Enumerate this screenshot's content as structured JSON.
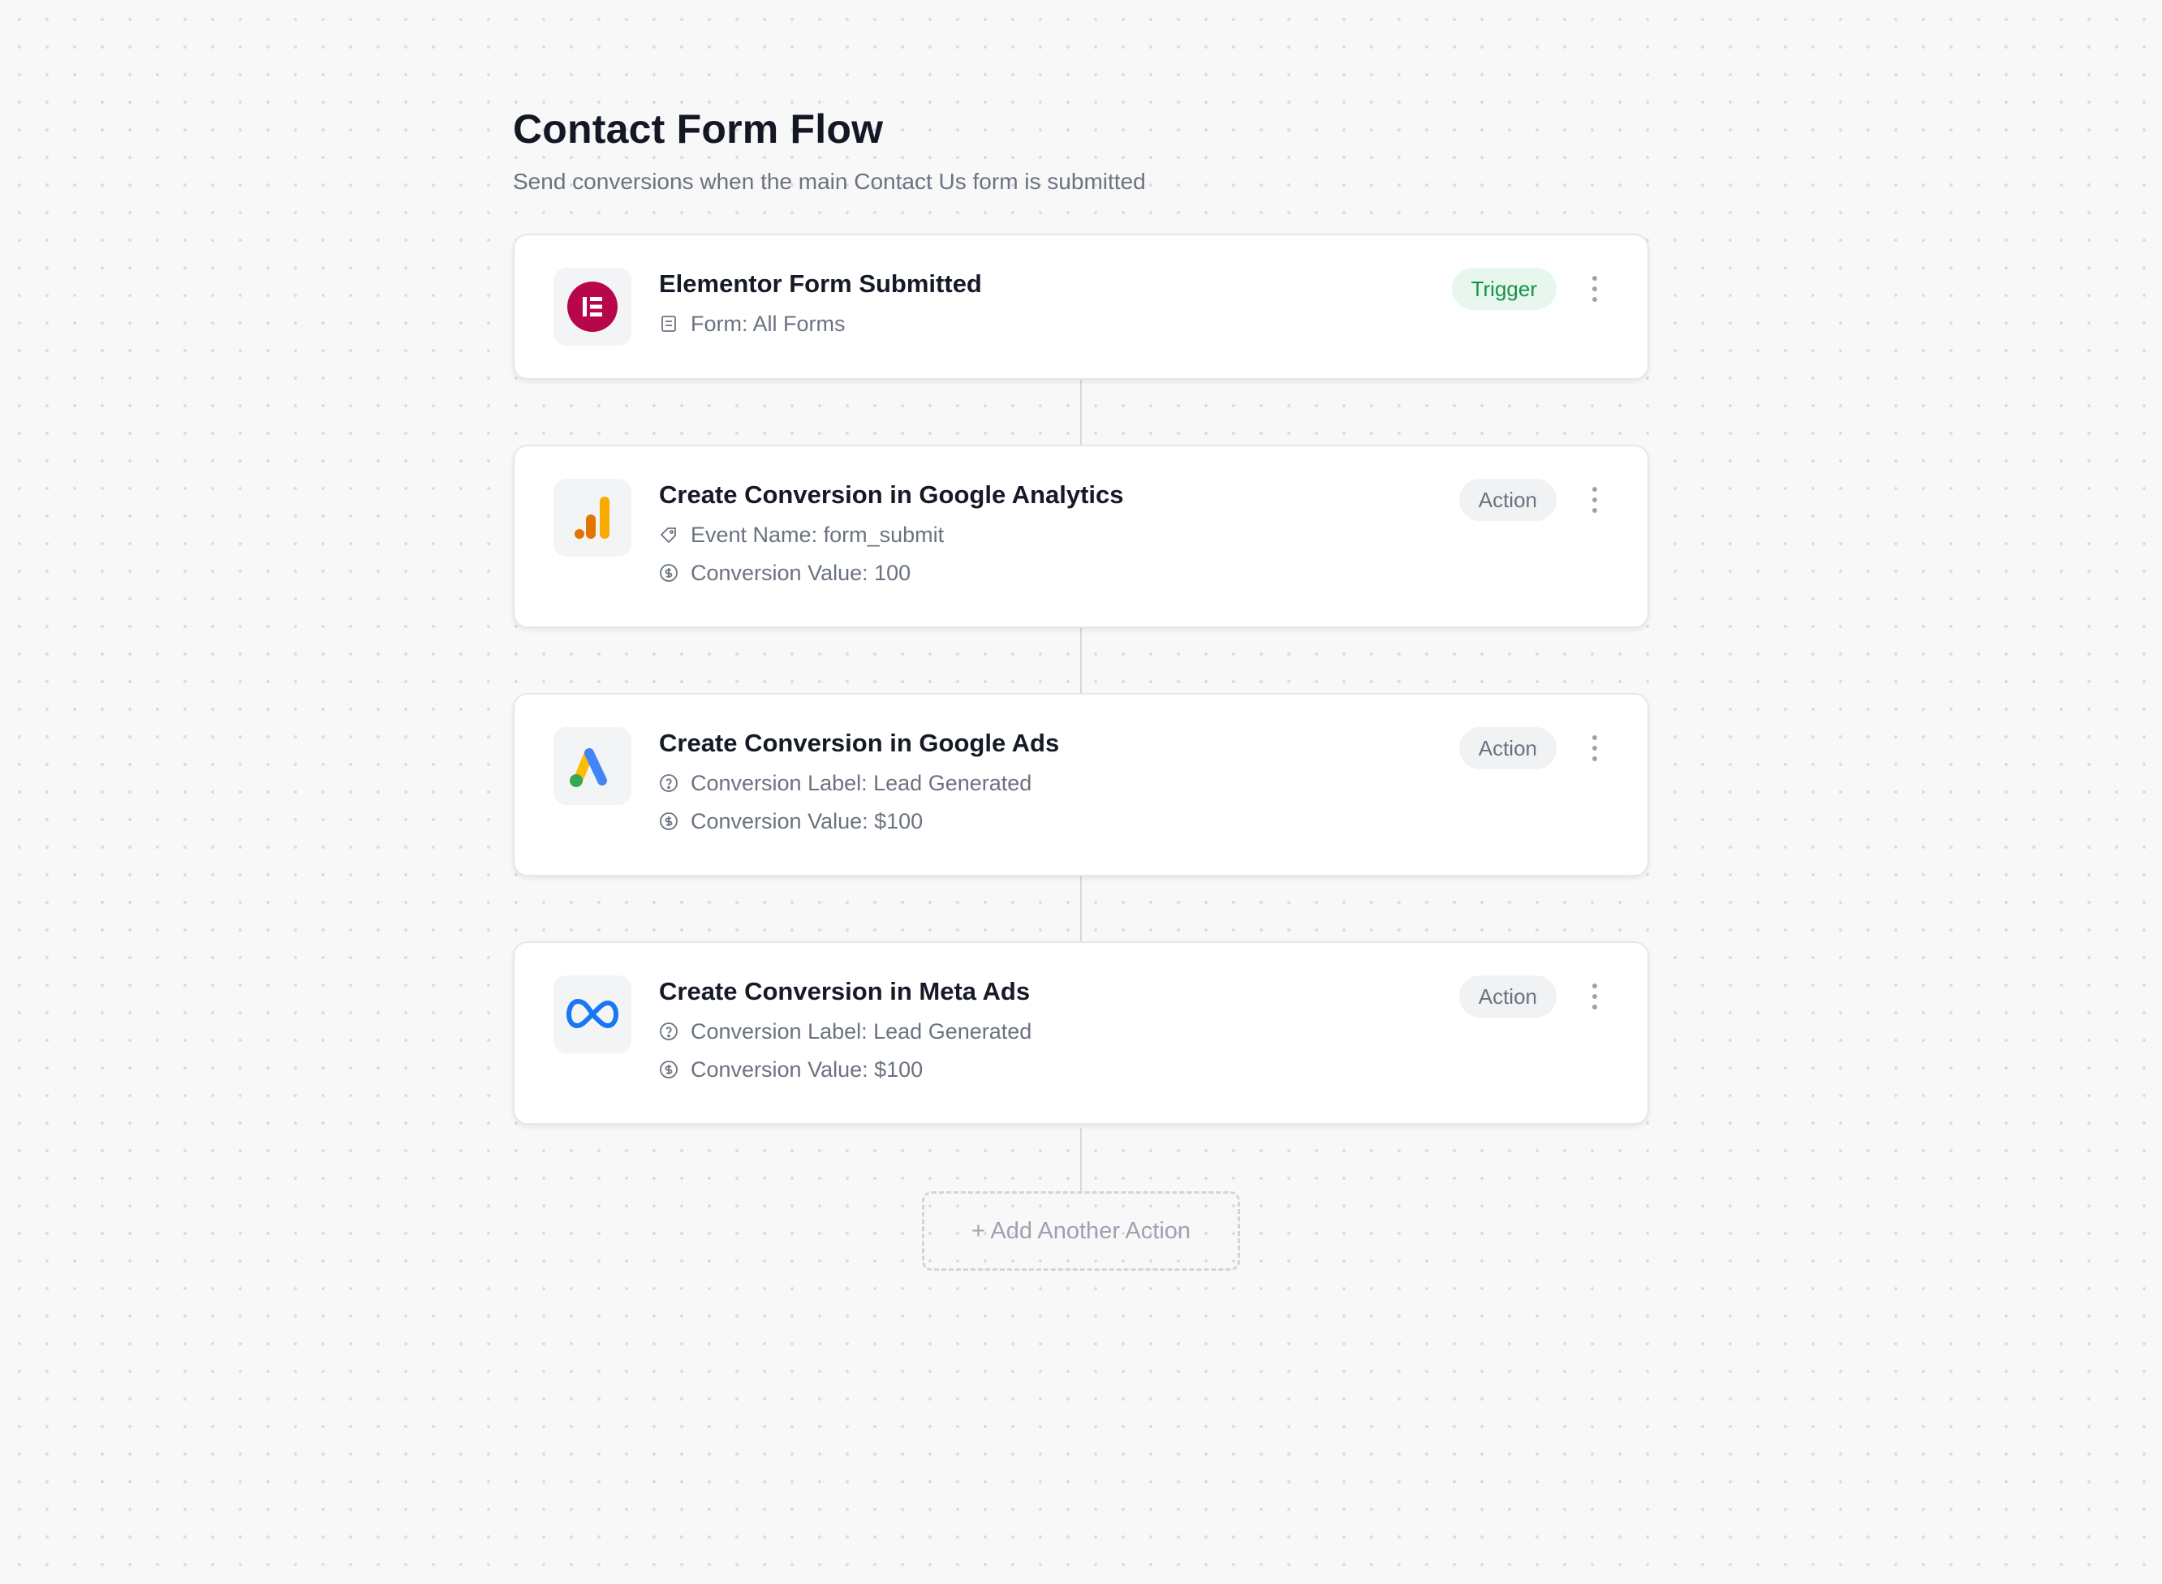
{
  "flow": {
    "title": "Contact Form Flow",
    "subtitle": "Send conversions when the main Contact Us form is submitted"
  },
  "steps": [
    {
      "title": "Elementor Form Submitted",
      "badge": "Trigger",
      "logo_icon": "elementor-logo-icon",
      "details": [
        {
          "icon": "form-icon",
          "text": "Form: All Forms"
        }
      ]
    },
    {
      "title": "Create Conversion in Google Analytics",
      "badge": "Action",
      "logo_icon": "google-analytics-logo-icon",
      "details": [
        {
          "icon": "tag-icon",
          "text": "Event Name: form_submit"
        },
        {
          "icon": "dollar-circle-icon",
          "text": "Conversion Value: 100"
        }
      ]
    },
    {
      "title": "Create Conversion in Google Ads",
      "badge": "Action",
      "logo_icon": "google-ads-logo-icon",
      "details": [
        {
          "icon": "help-circle-icon",
          "text": "Conversion Label: Lead Generated"
        },
        {
          "icon": "dollar-circle-icon",
          "text": "Conversion Value: $100"
        }
      ]
    },
    {
      "title": "Create Conversion in Meta Ads",
      "badge": "Action",
      "logo_icon": "meta-logo-icon",
      "details": [
        {
          "icon": "help-circle-icon",
          "text": "Conversion Label: Lead Generated"
        },
        {
          "icon": "dollar-circle-icon",
          "text": "Conversion Value: $100"
        }
      ]
    }
  ],
  "add_action_label": "+ Add Another Action",
  "colors": {
    "trigger_badge_bg": "#e8f7ee",
    "trigger_badge_text": "#15924a",
    "action_badge_bg": "#f1f2f4",
    "elementor_brand": "#b8064b",
    "meta_brand": "#1877f2"
  }
}
